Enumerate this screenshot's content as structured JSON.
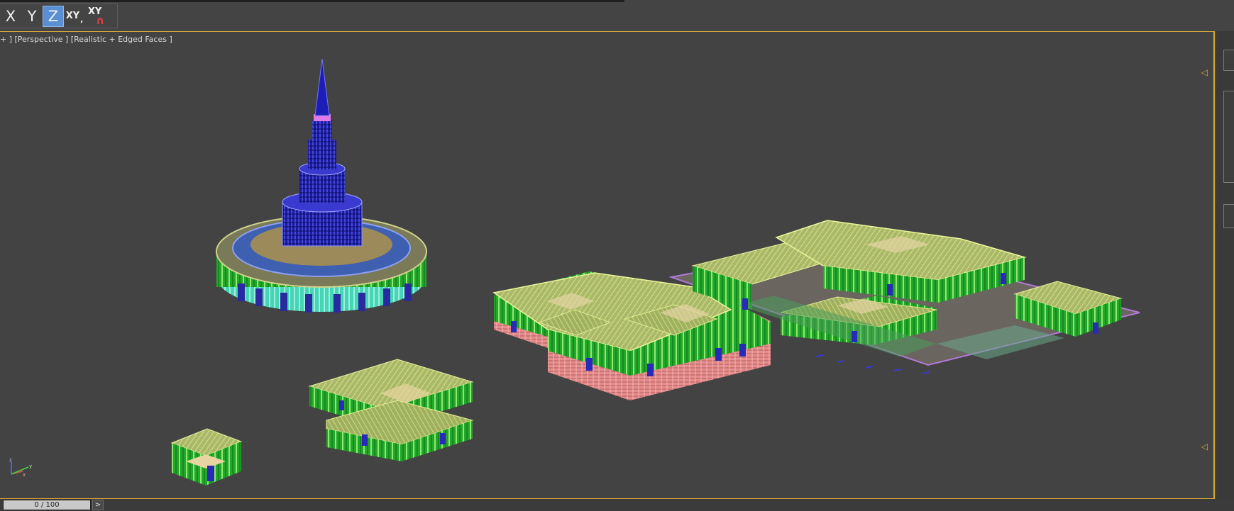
{
  "toolbar": {
    "axis_x": "X",
    "axis_y": "Y",
    "axis_z": "Z",
    "axis_xy": "XY",
    "axis_xy_comma": ",",
    "axis_xy_lock": "XY",
    "active_axis": "Z"
  },
  "viewport": {
    "label": "+ ] [Perspective ] [Realistic + Edged Faces ]",
    "left_marker": "◁",
    "scene_objects": [
      "tower-rotunda",
      "small-pavilion",
      "gallery-block",
      "main-palace",
      "palace-courtyard-complex"
    ]
  },
  "axis_tripod": {
    "z": "z",
    "x": "x",
    "y": "y"
  },
  "timeline": {
    "slider_label": "0 / 100",
    "next_label": ">"
  },
  "colors": {
    "accent_border": "#d6a83a",
    "active_axis": "#5a8fd3",
    "background": "#434343",
    "roof": "#b8c86a",
    "walls": "#2fb52f",
    "base": "#e38a8a",
    "tower": "#1a1aa0"
  }
}
